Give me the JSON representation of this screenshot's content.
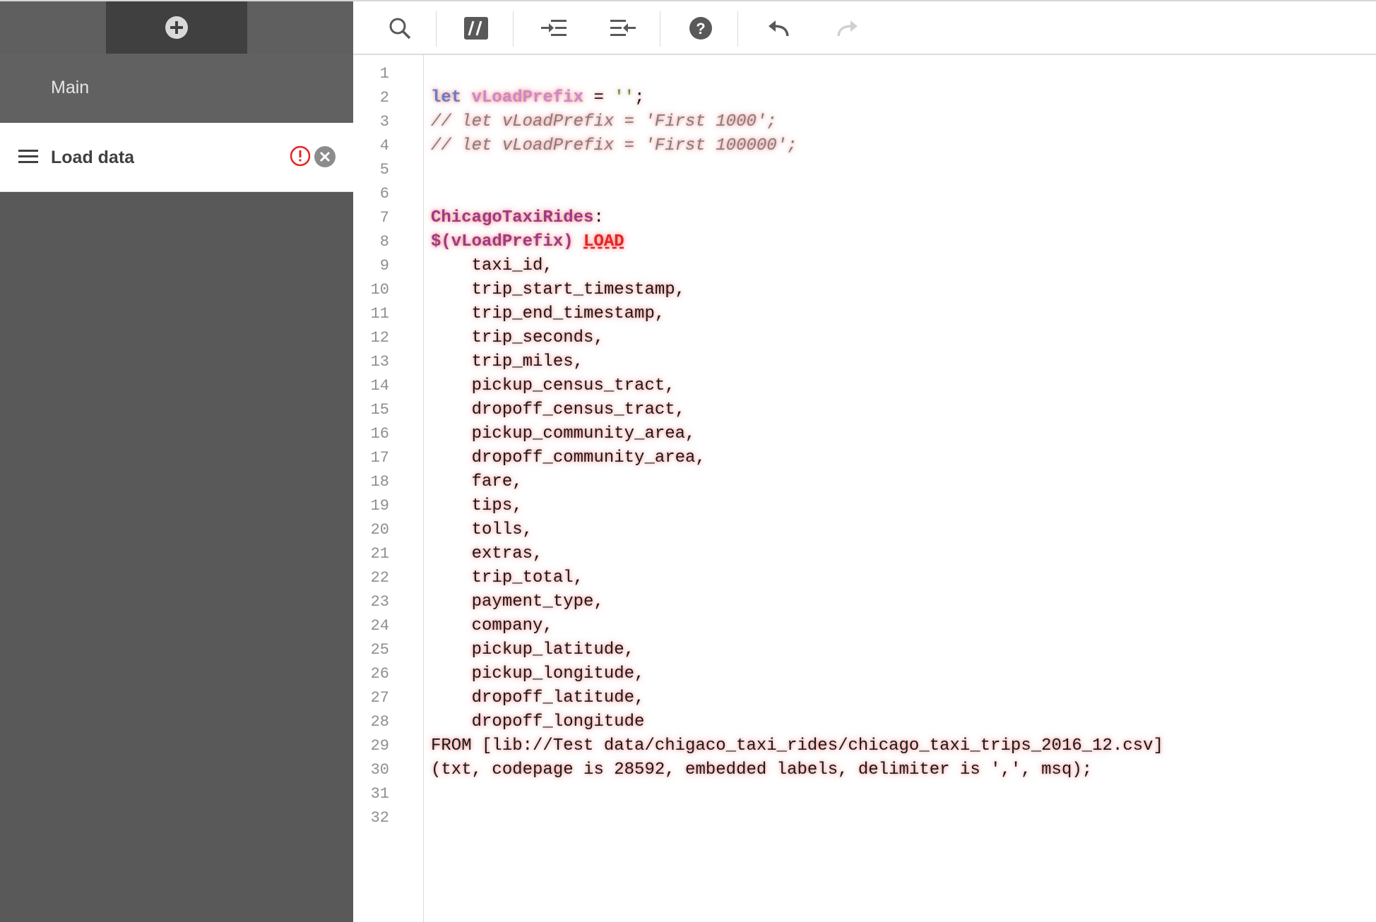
{
  "sidebar": {
    "add_button_icon": "plus-circle-icon",
    "items": [
      {
        "label": "Main"
      },
      {
        "label": "Load data",
        "status_icon": "error-icon",
        "action_icon": "remove-icon"
      }
    ]
  },
  "toolbar": {
    "buttons": [
      {
        "name": "search",
        "icon": "search-icon"
      },
      {
        "name": "comment",
        "icon": "comment-toggle-icon"
      },
      {
        "name": "indent",
        "icon": "indent-icon"
      },
      {
        "name": "outdent",
        "icon": "outdent-icon"
      },
      {
        "name": "help",
        "icon": "help-icon"
      },
      {
        "name": "undo",
        "icon": "undo-icon"
      },
      {
        "name": "redo",
        "icon": "redo-icon",
        "disabled": true
      }
    ]
  },
  "editor": {
    "line_numbers": [
      "1",
      "2",
      "3",
      "4",
      "5",
      "6",
      "7",
      "8",
      "9",
      "10",
      "11",
      "12",
      "13",
      "14",
      "15",
      "16",
      "17",
      "18",
      "19",
      "20",
      "21",
      "22",
      "23",
      "24",
      "25",
      "26",
      "27",
      "28",
      "29",
      "30",
      "31",
      "32"
    ],
    "lines": {
      "l2_kw": "let",
      "l2_var": "vLoadPrefix",
      "l2_eq": " = ",
      "l2_str": "''",
      "l2_end": ";",
      "l3": "// let vLoadPrefix = 'First 1000';",
      "l4": "// let vLoadPrefix = 'First 100000';",
      "l7": "ChicagoTaxiRides",
      "l7_colon": ":",
      "l8_prefix": "$(vLoadPrefix)",
      "l8_load": "LOAD",
      "l9": "    taxi_id,",
      "l10": "    trip_start_timestamp,",
      "l11": "    trip_end_timestamp,",
      "l12": "    trip_seconds,",
      "l13": "    trip_miles,",
      "l14": "    pickup_census_tract,",
      "l15": "    dropoff_census_tract,",
      "l16": "    pickup_community_area,",
      "l17": "    dropoff_community_area,",
      "l18": "    fare,",
      "l19": "    tips,",
      "l20": "    tolls,",
      "l21": "    extras,",
      "l22": "    trip_total,",
      "l23": "    payment_type,",
      "l24": "    company,",
      "l25": "    pickup_latitude,",
      "l26": "    pickup_longitude,",
      "l27": "    dropoff_latitude,",
      "l28": "    dropoff_longitude",
      "l29": "FROM [lib://Test data/chigaco_taxi_rides/chicago_taxi_trips_2016_12.csv]",
      "l30": "(txt, codepage is 28592, embedded labels, delimiter is ',', msq);"
    }
  },
  "colors": {
    "sidebar_bg": "#595959",
    "keyword": "#5c81c8",
    "variable": "#c78ac9",
    "string": "#3fa02f",
    "label": "#9b3b86",
    "error": "#e52424"
  }
}
